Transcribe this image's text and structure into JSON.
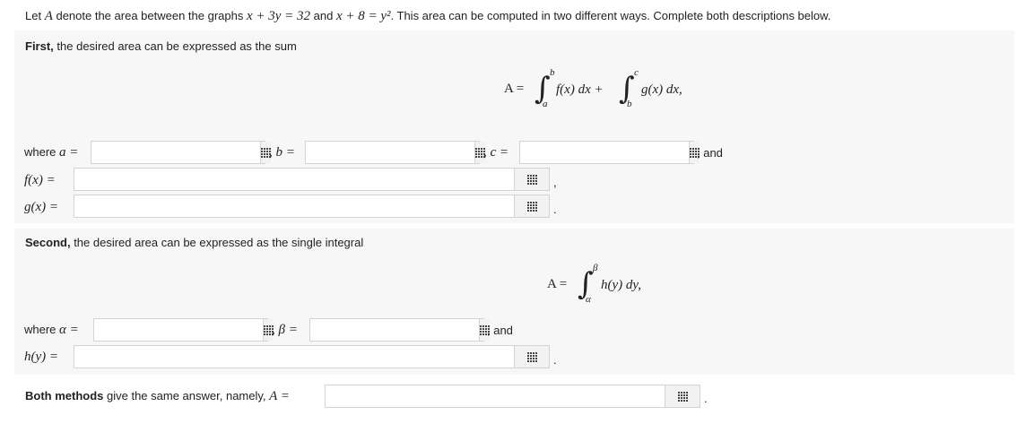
{
  "intro": {
    "p1": "Let ",
    "A": "A",
    "p2": " denote the area between the graphs ",
    "eq1": "x + 3y = 32",
    "p3": " and ",
    "eq2": "x + 8 = y²",
    "p4": ". This area can be computed in two different ways. Complete both descriptions below."
  },
  "first": {
    "bold": "First,",
    "rest": " the desired area can be expressed as the sum",
    "formula": {
      "lhs": "A =",
      "int1_upper": "b",
      "int1_lower": "a",
      "int1_body": "f(x) dx +",
      "int2_upper": "c",
      "int2_lower": "b",
      "int2_body": "g(x) dx,"
    },
    "where_text": "where",
    "a_label": "a =",
    "b_label": ", b =",
    "c_label": ", c =",
    "and_text": ", and",
    "f_label": "f(x) =",
    "f_suffix": ",",
    "g_label": "g(x) =",
    "g_suffix": "."
  },
  "second": {
    "bold": "Second,",
    "rest": " the desired area can be expressed as the single integral",
    "formula": {
      "lhs": "A =",
      "upper": "β",
      "lower": "α",
      "body": "h(y) dy,"
    },
    "where_text": "where",
    "alpha_label": "α =",
    "beta_label": ", β =",
    "and_text": ", and",
    "h_label": "h(y) =",
    "h_suffix": "."
  },
  "final": {
    "bold": "Both methods",
    "rest": " give the same answer, namely, ",
    "A_label": "A =",
    "suffix": "."
  },
  "inputs": {
    "a": "",
    "b": "",
    "c": "",
    "f": "",
    "g": "",
    "alpha": "",
    "beta": "",
    "h": "",
    "A": ""
  },
  "icons": {
    "keypad": "keypad-grid-icon"
  }
}
